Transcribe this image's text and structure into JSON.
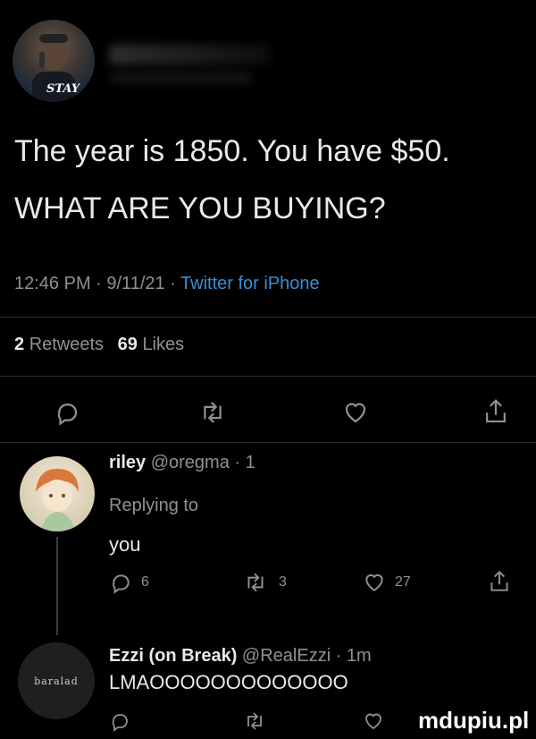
{
  "main_tweet": {
    "avatar_text": "STAY",
    "text_line1": "The year is 1850. You have $50.",
    "text_line2": "WHAT ARE YOU BUYING?",
    "time": "12:46 PM · 9/11/21 · ",
    "source": "Twitter for iPhone",
    "retweets_count": "2",
    "retweets_label": "Retweets",
    "likes_count": "69",
    "likes_label": "Likes"
  },
  "replies": [
    {
      "name": "riley",
      "handle": "@oregma · 1",
      "replying_to": "Replying to",
      "text": "you",
      "reply_count": "6",
      "retweet_count": "3",
      "like_count": "27"
    },
    {
      "name": "Ezzi (on Break)",
      "handle": "@RealEzzi · 1m",
      "avatar_text": "baralad",
      "text": "LMAOOOOOOOOOOOOO"
    }
  ],
  "watermark": "mdupiu.pl",
  "icons": [
    "reply-icon",
    "retweet-icon",
    "like-icon",
    "share-icon"
  ]
}
